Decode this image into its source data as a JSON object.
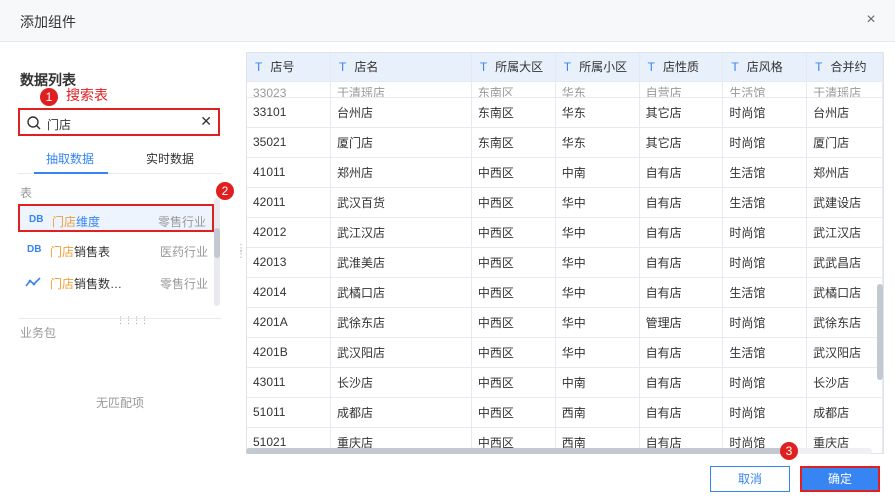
{
  "dialog": {
    "title": "添加组件",
    "close": "×"
  },
  "left": {
    "section_title": "数据列表",
    "anno1": {
      "num": "1",
      "text": "搜索表"
    },
    "anno2": {
      "num": "2"
    },
    "anno3": {
      "num": "3"
    },
    "search": {
      "value": "门店"
    },
    "tabs": [
      "抽取数据",
      "实时数据"
    ],
    "table_section": "表",
    "items": [
      {
        "icon": "DB",
        "hl": "门店",
        "rest": "维度",
        "industry": "零售行业"
      },
      {
        "icon": "DB",
        "hl": "门店",
        "rest": "销售表",
        "industry": "医药行业"
      },
      {
        "icon": "line",
        "hl": "门店",
        "rest": "销售数…",
        "industry": "零售行业"
      }
    ],
    "biz_section": "业务包",
    "empty": "无匹配项"
  },
  "grid": {
    "columns": [
      "店号",
      "店名",
      "所属大区",
      "所属小区",
      "店性质",
      "店风格",
      "合并约"
    ],
    "cut_row": [
      "33023",
      "于清瑶店",
      "东南区",
      "华东",
      "自营店",
      "生活馆",
      "于清瑶店"
    ],
    "rows": [
      [
        "33101",
        "台州店",
        "东南区",
        "华东",
        "其它店",
        "时尚馆",
        "台州店"
      ],
      [
        "35021",
        "厦门店",
        "东南区",
        "华东",
        "其它店",
        "时尚馆",
        "厦门店"
      ],
      [
        "41011",
        "郑州店",
        "中西区",
        "中南",
        "自有店",
        "生活馆",
        "郑州店"
      ],
      [
        "42011",
        "武汉百货",
        "中西区",
        "华中",
        "自有店",
        "生活馆",
        "武建设店"
      ],
      [
        "42012",
        "武江汉店",
        "中西区",
        "华中",
        "自有店",
        "时尚馆",
        "武江汉店"
      ],
      [
        "42013",
        "武淮美店",
        "中西区",
        "华中",
        "自有店",
        "时尚馆",
        "武武昌店"
      ],
      [
        "42014",
        "武橘口店",
        "中西区",
        "华中",
        "自有店",
        "生活馆",
        "武橘口店"
      ],
      [
        "4201A",
        "武徐东店",
        "中西区",
        "华中",
        "管理店",
        "时尚馆",
        "武徐东店"
      ],
      [
        "4201B",
        "武汉阳店",
        "中西区",
        "华中",
        "自有店",
        "生活馆",
        "武汉阳店"
      ],
      [
        "43011",
        "长沙店",
        "中西区",
        "中南",
        "自有店",
        "时尚馆",
        "长沙店"
      ],
      [
        "51011",
        "成都店",
        "中西区",
        "西南",
        "自有店",
        "时尚馆",
        "成都店"
      ],
      [
        "51021",
        "重庆店",
        "中西区",
        "西南",
        "自有店",
        "时尚馆",
        "重庆店"
      ]
    ]
  },
  "footer": {
    "cancel": "取消",
    "ok": "确定"
  },
  "colors": {
    "accent": "#3685f2",
    "annotation": "#e02020",
    "highlight": "#f29d38"
  }
}
